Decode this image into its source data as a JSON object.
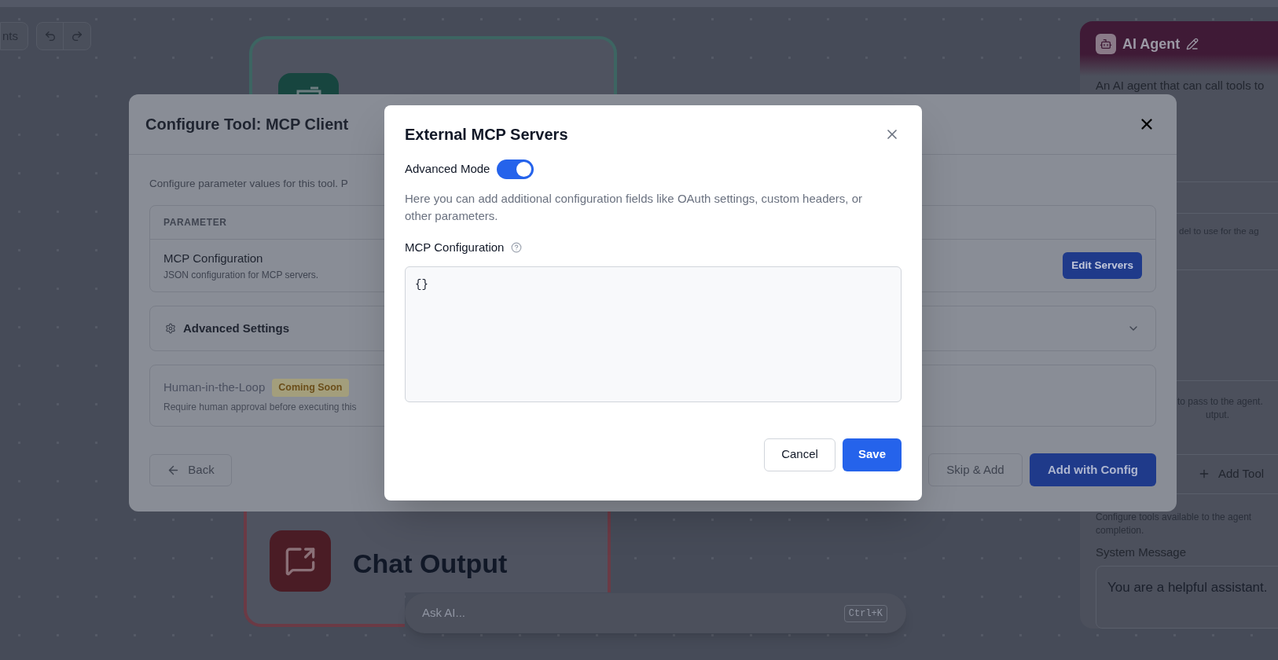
{
  "toolbar": {
    "partial_button": "nts",
    "history_buttons": [
      {
        "kind": "undo"
      },
      {
        "kind": "redo"
      }
    ]
  },
  "canvas": {
    "nodes": [
      {
        "kind": "input"
      },
      {
        "kind": "output",
        "title": "Chat Output"
      }
    ]
  },
  "ask_ai": {
    "placeholder": "Ask AI...",
    "shortcut": "Ctrl+K"
  },
  "agent_panel": {
    "title": "AI Agent",
    "description": "An AI agent that can call tools to",
    "model_hint": "del to use for the ag",
    "input_hint": [
      "to pass to the agent.",
      "utput."
    ],
    "add_tool": "Add Tool",
    "tools_hint": [
      "Configure tools available to the agent",
      "completion."
    ],
    "system_message": {
      "label": "System Message",
      "value": "You are a helpful assistant."
    }
  },
  "config_dialog": {
    "title": "Configure Tool: MCP Client",
    "intro": "Configure parameter values for this tool. P",
    "table": {
      "column_1": "PARAMETER",
      "rows": [
        {
          "name": "MCP Configuration",
          "description": "JSON configuration for MCP servers.",
          "action": "Edit Servers"
        }
      ]
    },
    "advanced_settings": {
      "label": "Advanced Settings",
      "expanded": false
    },
    "human_in_the_loop": {
      "label": "Human-in-the-Loop",
      "badge": "Coming Soon",
      "description": "Require human approval before executing this",
      "disabled": true
    },
    "buttons": {
      "back": "Back",
      "skip": "Skip & Add",
      "primary": "Add with Config"
    }
  },
  "mcp_dialog": {
    "title": "External MCP Servers",
    "advanced_mode": {
      "label": "Advanced Mode",
      "on": true
    },
    "description": "Here you can add additional configuration fields like OAuth settings, custom headers, or other parameters.",
    "config_label": "MCP Configuration",
    "config_value": "{}",
    "buttons": {
      "cancel": "Cancel",
      "save": "Save"
    }
  }
}
